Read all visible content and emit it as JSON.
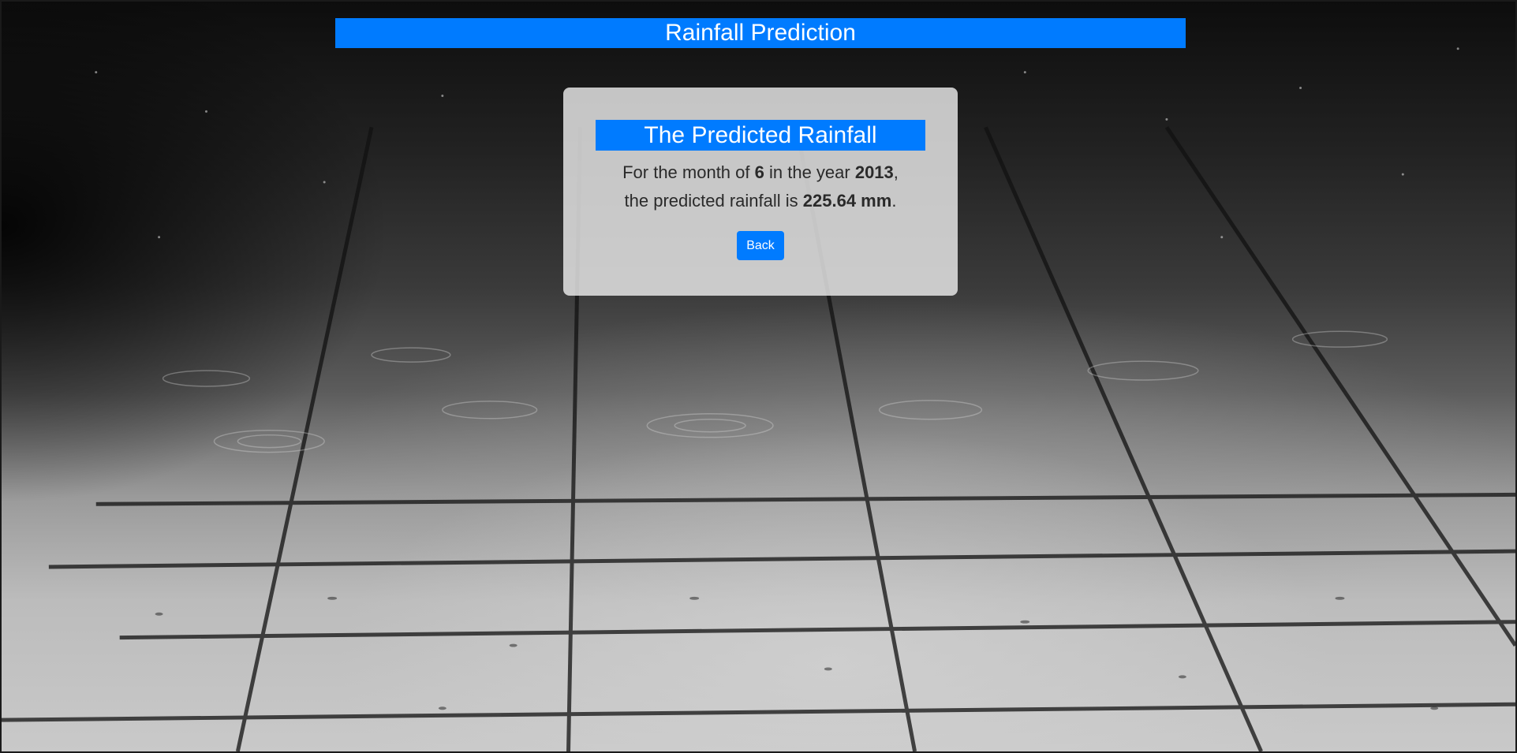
{
  "header": {
    "title": "Rainfall Prediction"
  },
  "result_card": {
    "heading": "The Predicted Rainfall",
    "line1_prefix": "For the month of ",
    "month": "6",
    "line1_middle": " in the year ",
    "year": "2013",
    "line1_suffix": ",",
    "line2_prefix": "the predicted rainfall is ",
    "rainfall": "225.64 mm",
    "line2_suffix": ".",
    "back_label": "Back"
  },
  "colors": {
    "accent": "#007bff",
    "card_background": "#ebebeb"
  }
}
